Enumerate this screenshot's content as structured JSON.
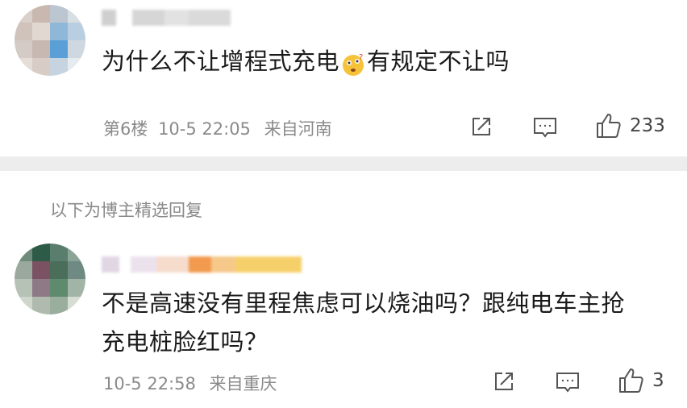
{
  "comments": [
    {
      "text": "为什么不让增程式充电",
      "emoji": "thinking-face",
      "text_after": "有规定不让吗",
      "floor": "第6楼",
      "time": "10-5 22:05",
      "location": "来自河南",
      "like_count": "233"
    }
  ],
  "section_label": "以下为博主精选回复",
  "replies": [
    {
      "text_line1": "不是高速没有里程焦虑可以烧油吗？跟纯电车主抢",
      "text_line2": "充电桩脸红吗？",
      "time": "10-5 22:58",
      "location": "来自重庆",
      "like_count": "3"
    }
  ],
  "icons": {
    "share": "share-icon",
    "comment": "comment-icon",
    "like": "thumbs-up-icon"
  },
  "colors": {
    "meta_text": "#8a8a8a",
    "divider": "#ededed",
    "emoji_face": "#f5c23a"
  }
}
